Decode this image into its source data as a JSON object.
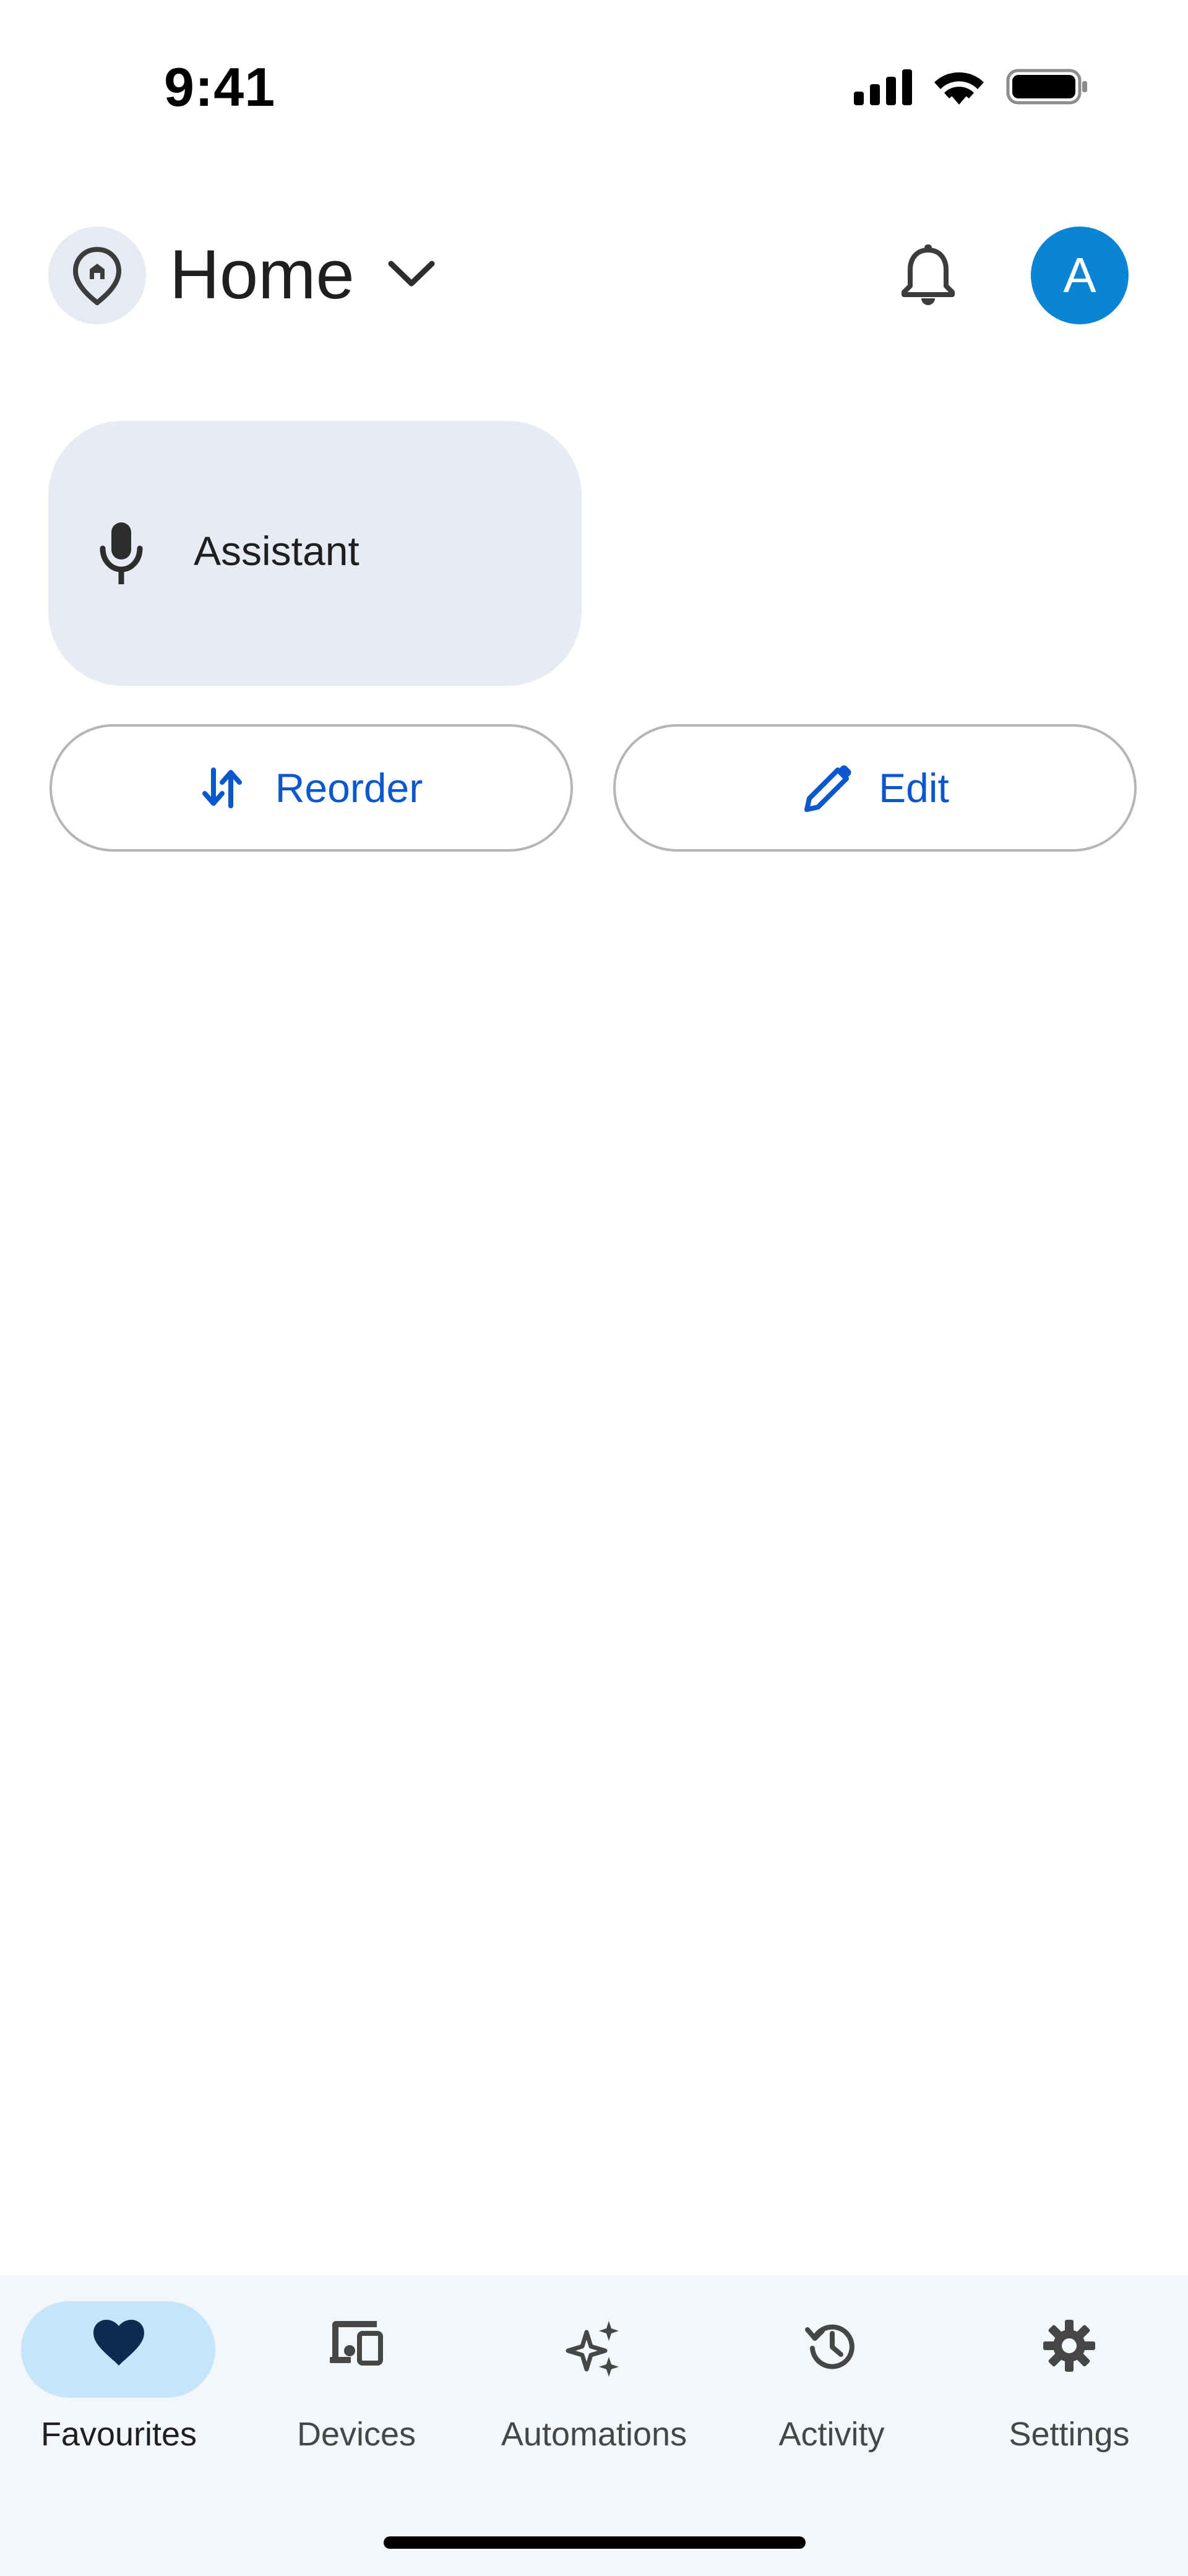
{
  "status_bar": {
    "time": "9:41"
  },
  "header": {
    "title": "Home",
    "avatar_initial": "A"
  },
  "assistant": {
    "label": "Assistant"
  },
  "actions": {
    "reorder_label": "Reorder",
    "edit_label": "Edit"
  },
  "bottom_nav": {
    "items": [
      {
        "label": "Favourites",
        "icon": "heart-icon",
        "active": true
      },
      {
        "label": "Devices",
        "icon": "devices-icon",
        "active": false
      },
      {
        "label": "Automations",
        "icon": "sparkle-icon",
        "active": false
      },
      {
        "label": "Activity",
        "icon": "history-icon",
        "active": false
      },
      {
        "label": "Settings",
        "icon": "gear-icon",
        "active": false
      }
    ]
  },
  "colors": {
    "accent": "#0b57d0",
    "avatar": "#0b84d6",
    "active_pill": "#c5e5fb",
    "card": "#e7ebf4",
    "nav_bg": "#f3f6fa"
  }
}
